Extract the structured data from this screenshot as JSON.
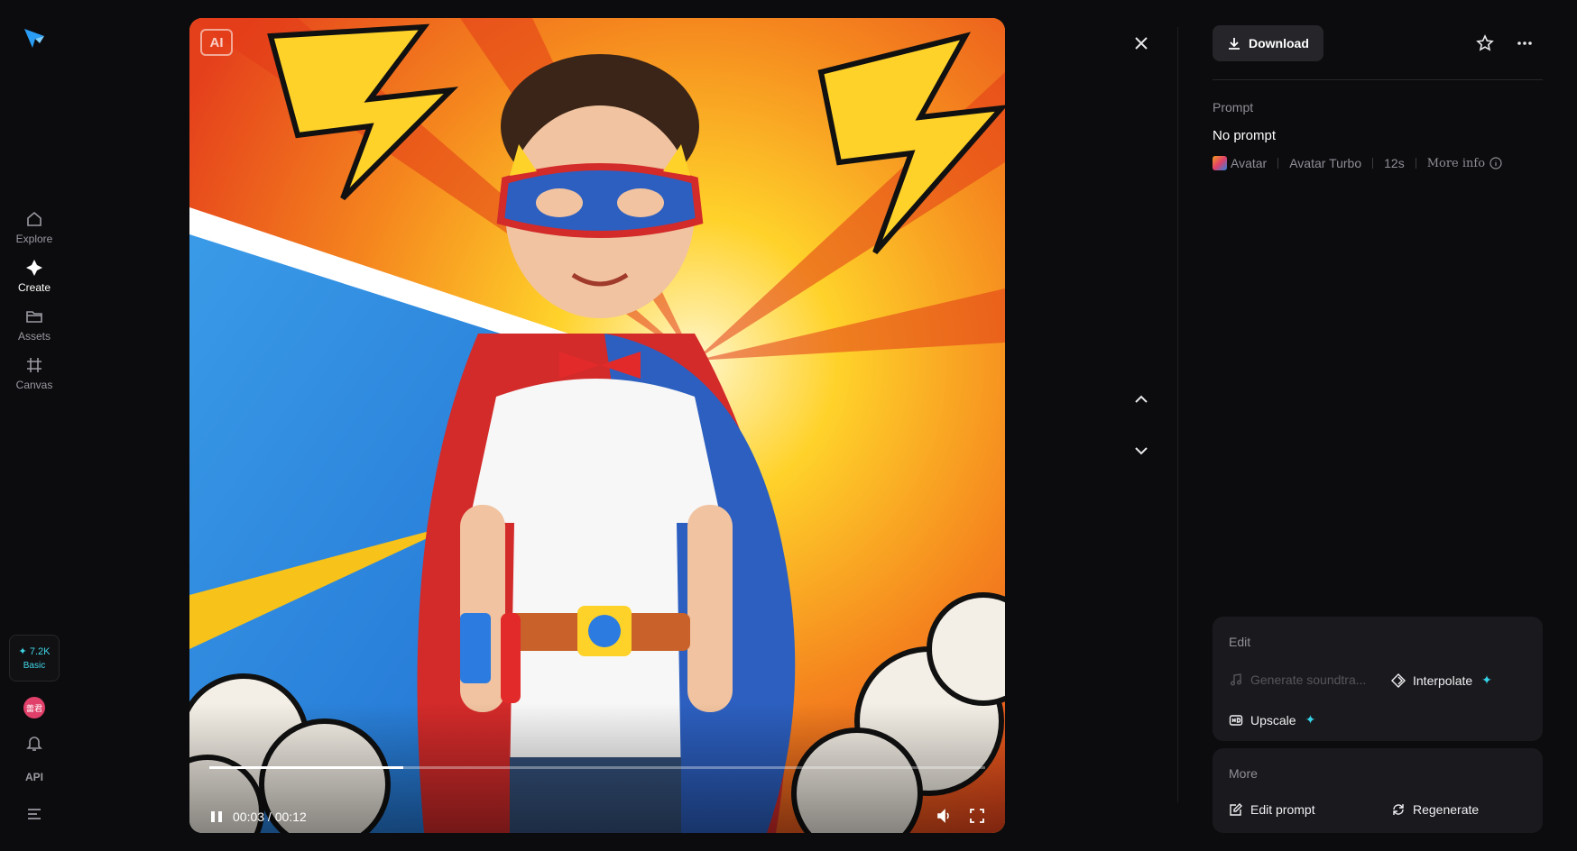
{
  "sidebar": {
    "items": [
      {
        "label": "Explore",
        "icon": "home-icon"
      },
      {
        "label": "Create",
        "icon": "sparkle-icon"
      },
      {
        "label": "Assets",
        "icon": "folder-icon"
      },
      {
        "label": "Canvas",
        "icon": "canvas-icon"
      }
    ],
    "credits": {
      "amount": "✦ 7.2K",
      "plan": "Basic"
    },
    "avatar_text": "蕾君",
    "api_label": "API"
  },
  "viewer": {
    "ai_badge": "AI",
    "time_current": "00:03",
    "time_total": "00:12",
    "time_separator": " / ",
    "progress": 0.25
  },
  "panel": {
    "download_label": "Download",
    "prompt_label": "Prompt",
    "prompt_text": "No prompt",
    "meta": {
      "model": "Avatar",
      "variant": "Avatar Turbo",
      "duration": "12s",
      "more_info": "More info"
    },
    "edit": {
      "title": "Edit",
      "generate_soundtrack": "Generate soundtra...",
      "interpolate": "Interpolate",
      "upscale": "Upscale"
    },
    "more": {
      "title": "More",
      "edit_prompt": "Edit prompt",
      "regenerate": "Regenerate"
    }
  },
  "colors": {
    "background": "#0c0c0e",
    "card": "#1a1a1e",
    "accent": "#35d2e8",
    "logo": "#2a9df4"
  }
}
